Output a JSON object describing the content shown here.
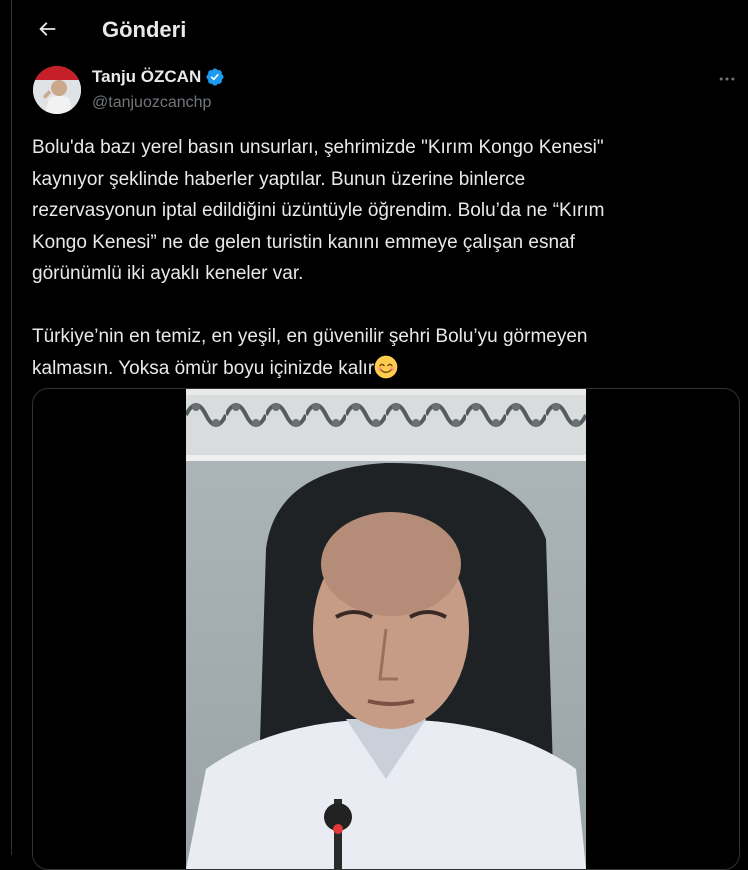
{
  "header": {
    "title": "Gönderi",
    "back_icon": "arrow-left-icon"
  },
  "author": {
    "name": "Tanju ÖZCAN",
    "handle": "@tanjuozcanchp",
    "verified_icon": "verified-badge-icon",
    "verified_color": "#1d9bf0"
  },
  "tweet": {
    "text": "Bolu'da bazı yerel basın unsurları, şehrimizde \"Kırım Kongo Kenesi\"\nkaynıyor şeklinde haberler yaptılar. Bunun üzerine binlerce\nrezervasyonun iptal edildiğini üzüntüyle öğrendim. Bolu’da ne “Kırım\nKongo Kenesi” ne de gelen turistin kanını emmeye çalışan esnaf\ngörünümlü iki ayaklı keneler var.\n\nTürkiye’nin en temiz, en yeşil, en güvenilir şehri Bolu’yu görmeyen\nkalmasın. Yoksa ömür boyu içinizde kalır",
    "emoji": "smiling-face-with-smiling-eyes-emoji"
  },
  "media": {
    "type": "video-thumbnail"
  },
  "colors": {
    "background": "#000000",
    "text": "#e7e9ea",
    "secondary": "#71767b",
    "border": "#2f3336"
  }
}
